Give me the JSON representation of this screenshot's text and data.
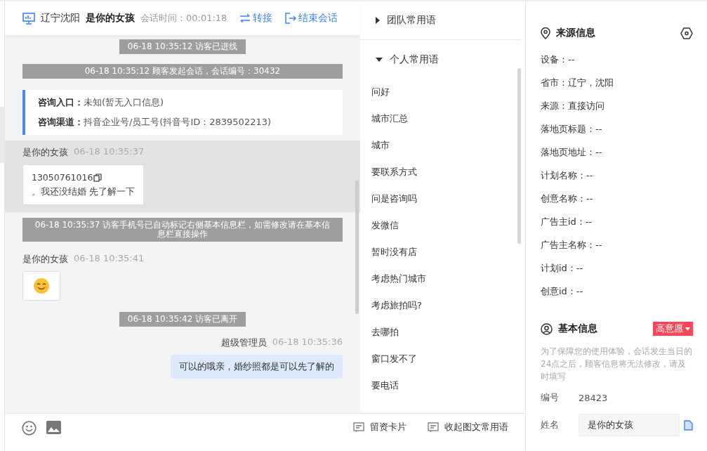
{
  "header": {
    "location": "辽宁沈阳",
    "visitor": "是你的女孩",
    "session_time": "会话时间：00:01:18",
    "actions": [
      {
        "kind": "transfer",
        "label": "转接"
      },
      {
        "kind": "end",
        "label": "结束会话"
      }
    ]
  },
  "messages": [
    {
      "kind": "system",
      "text": "06-18 10:35:12 访客已进线"
    },
    {
      "kind": "system",
      "text": "06-18 10:35:12 顾客发起会话，会话编号：30432"
    },
    {
      "kind": "info",
      "rows": [
        {
          "label": "咨询入口：",
          "value": "未知(暂无入口信息)"
        },
        {
          "label": "咨询渠道：",
          "value": "抖音企业号/员工号(抖音号ID：2839502213)"
        }
      ]
    },
    {
      "kind": "visitor",
      "sender": "是你的女孩",
      "time": "06-18 10:35:37",
      "phone": "13050761016",
      "text": "。我还没结婚 先了解一下",
      "selected": true
    },
    {
      "kind": "system",
      "text": "06-18 10:35:37 访客手机号已自动标记右侧基本信息栏，如需修改请在基本信息栏直接操作"
    },
    {
      "kind": "visitor_emoji",
      "sender": "是你的女孩",
      "time": "06-18 10:35:41",
      "selected": false
    },
    {
      "kind": "system",
      "text": "06-18 10:35:42 访客已离开"
    },
    {
      "kind": "agent",
      "sender": "超级管理员",
      "time": "06-18 10:35:36",
      "text": "可以的哦亲，婚纱照都是可以先了解的"
    }
  ],
  "phrases": {
    "groups": [
      {
        "label": "团队常用语",
        "expanded": false
      },
      {
        "label": "个人常用语",
        "expanded": true
      }
    ],
    "items": [
      "问好",
      "城市汇总",
      "城市",
      "要联系方式",
      "问是咨询吗",
      "发微信",
      "暂时没有店",
      "考虑热门城市",
      "考虑旅拍吗?",
      "去哪拍",
      "窗口发不了",
      "要电话"
    ]
  },
  "toolbar": {
    "actions": [
      "留资卡片",
      "收起图文常用语"
    ]
  },
  "source_info": {
    "title": "来源信息",
    "fields": [
      "设备：--",
      "省市：辽宁，沈阳",
      "来源：直接访问",
      "落地页标题：--",
      "落地页地址：--",
      "计划名称：--",
      "创意名称：--",
      "广告主id：--",
      "广告主名称：--",
      "计划id：--",
      "创意id：--"
    ]
  },
  "basic_info": {
    "title": "基本信息",
    "intent": "高意愿",
    "notice": "为了保障您的使用体验，会话发生当日的24点之后，顾客信息将无法修改，请及时填写",
    "number_label": "编号",
    "number": "28423",
    "name_label": "姓名",
    "name_value": "是你的女孩"
  }
}
